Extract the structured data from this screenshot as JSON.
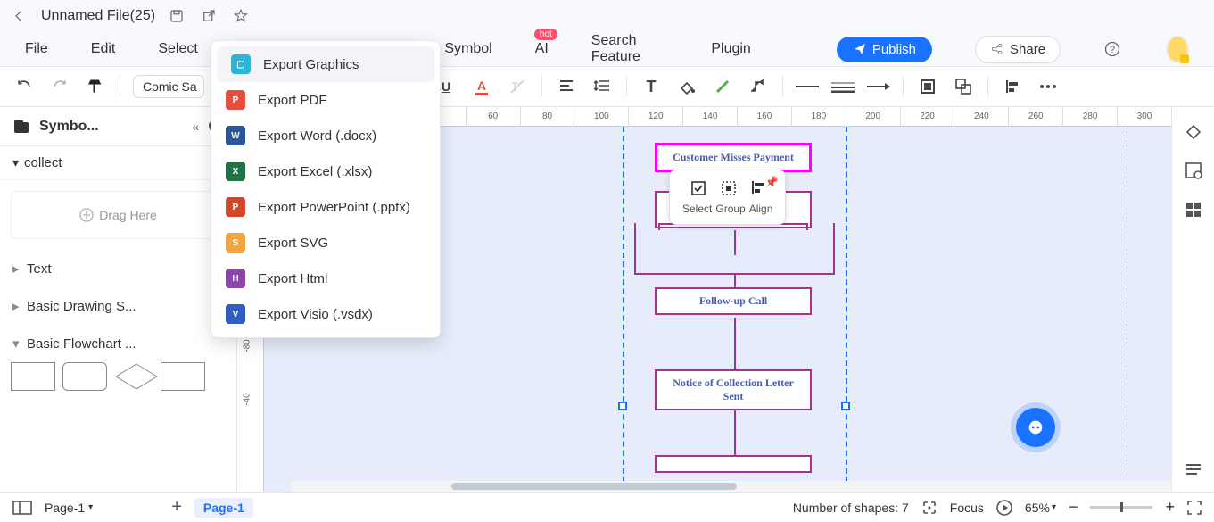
{
  "titlebar": {
    "filename": "Unnamed File(25)"
  },
  "menu": {
    "items": [
      "File",
      "Edit",
      "Select",
      "Symbol",
      "AI",
      "Search Feature",
      "Plugin"
    ],
    "hot_label": "hot",
    "publish_label": "Publish",
    "share_label": "Share"
  },
  "toolbar": {
    "font_name": "Comic Sa"
  },
  "sidebar": {
    "title": "Symbo...",
    "collect_label": "collect",
    "drag_here": "Drag Here",
    "accordion": [
      "Text",
      "Basic Drawing S...",
      "Basic Flowchart ..."
    ]
  },
  "ruler_h": [
    "60",
    "80",
    "100",
    "120",
    "140",
    "160",
    "180",
    "200",
    "220",
    "240",
    "260",
    "280",
    "300"
  ],
  "ruler_v": [
    "-80",
    "-40"
  ],
  "flow": {
    "box1": "Customer Misses Payment",
    "box2": "",
    "box3": "Follow-up Call",
    "box4": "Notice of Collection Letter Sent"
  },
  "floating": {
    "select": "Select",
    "group": "Group",
    "align": "Align"
  },
  "export_menu": {
    "items": [
      {
        "label": "Export Graphics",
        "color": "#2bb5d8"
      },
      {
        "label": "Export PDF",
        "color": "#e74c3c"
      },
      {
        "label": "Export Word (.docx)",
        "color": "#2b579a"
      },
      {
        "label": "Export Excel (.xlsx)",
        "color": "#217346"
      },
      {
        "label": "Export PowerPoint (.pptx)",
        "color": "#d24726"
      },
      {
        "label": "Export SVG",
        "color": "#f2a53c"
      },
      {
        "label": "Export Html",
        "color": "#8e44ad"
      },
      {
        "label": "Export Visio (.vsdx)",
        "color": "#2f5fc4"
      }
    ]
  },
  "status": {
    "page_select": "Page-1",
    "page_tab": "Page-1",
    "shapes_label": "Number of shapes: 7",
    "focus_label": "Focus",
    "zoom": "65%"
  }
}
